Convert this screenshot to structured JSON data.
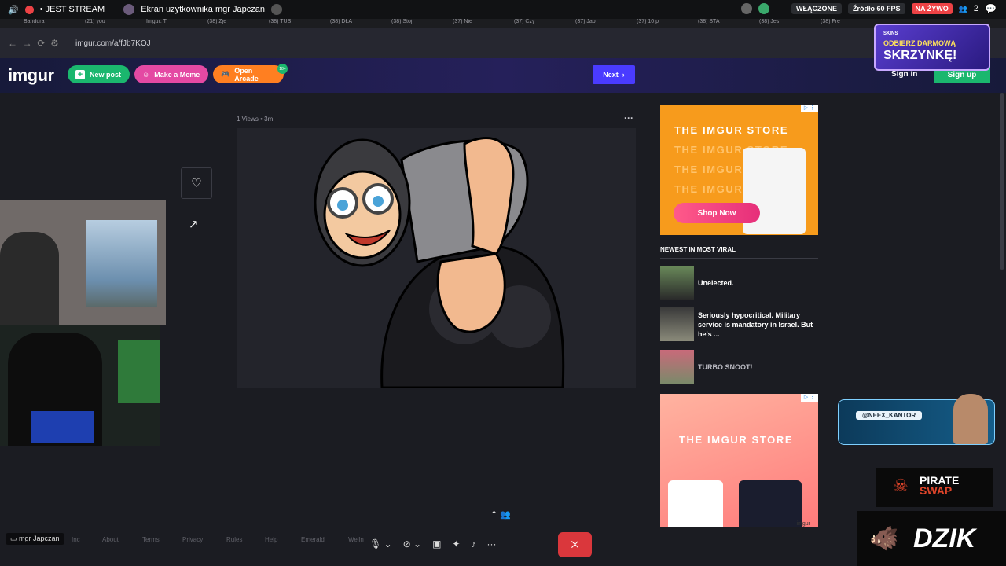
{
  "discord": {
    "live_label": "• JEST STREAM",
    "screen_title": "Ekran użytkownika mgr Japczan",
    "mode_badge": "WŁĄCZONE",
    "source": "Źródło 60 FPS",
    "live_badge": "NA ŻYWO",
    "viewers": "2"
  },
  "tabs": [
    "Bandura",
    "(21) you",
    "Imgur: T",
    "(38) Zje",
    "(38) TUS",
    "(38) DŁA",
    "(38) Stoj",
    "(37) Nie",
    "(37) Czy",
    "(37) Jap",
    "(37) 10 p",
    "(38) STA",
    "(38) Jes",
    "(38) Fre"
  ],
  "browser": {
    "url": "imgur.com/a/fJb7KOJ"
  },
  "header": {
    "logo": "imgur",
    "new_post": "New post",
    "make_meme": "Make a Meme",
    "open_arcade": "Open Arcade",
    "arcade_badge": "18+",
    "next": "Next",
    "sign_in": "Sign in",
    "sign_up": "Sign up"
  },
  "post": {
    "views": "1 Views",
    "age": "3m"
  },
  "ad_top": {
    "title": "THE IMGUR STORE",
    "cta": "Shop Now"
  },
  "newest": {
    "heading": "NEWEST IN MOST VIRAL",
    "items": [
      {
        "title": "Unelected."
      },
      {
        "title": "Seriously hypocritical. Military service is mandatory in Israel. But he's ..."
      },
      {
        "title": "TURBO SNOOT!"
      }
    ]
  },
  "ad_bottom": {
    "title": "THE IMGUR STORE",
    "brand": "imgur"
  },
  "footer": {
    "links": [
      "Inc",
      "About",
      "Terms",
      "Privacy",
      "Rules",
      "Help",
      "Emerald",
      "Welln"
    ]
  },
  "stream": {
    "username": "mgr Japczan"
  },
  "overlays": {
    "skins_brand": "SKINS",
    "skins_line1": "ODBIERZ DARMOWĄ",
    "skins_line2": "SKRZYNKĘ!",
    "instagram": "@NEEX_KANTOR",
    "pirate_line1": "PIRATE",
    "pirate_line2": "SWAP",
    "dzik": "DZIK"
  },
  "colors": {
    "accent_green": "#1bb76e",
    "accent_pink": "#e449a3",
    "accent_orange": "#ff7f21",
    "next_blue": "#4a3bff",
    "leave_red": "#da373c"
  }
}
